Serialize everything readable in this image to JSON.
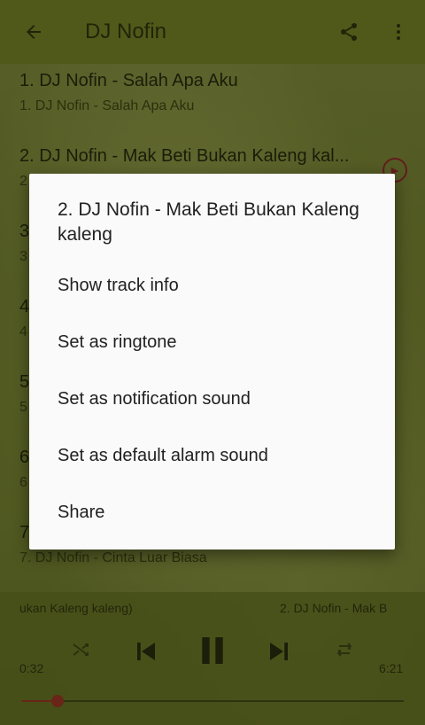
{
  "toolbar": {
    "back_icon": "arrow-back-icon",
    "title": "DJ Nofin",
    "share_icon": "share-icon",
    "more_icon": "more-vert-icon"
  },
  "tracks": [
    {
      "title": "1. DJ Nofin - Salah Apa Aku",
      "subtitle": "1. DJ Nofin - Salah Apa Aku"
    },
    {
      "title": "2. DJ Nofin - Mak Beti Bukan Kaleng kal...",
      "subtitle": "2"
    },
    {
      "title": "3",
      "subtitle": "3"
    },
    {
      "title": "4",
      "subtitle": "4"
    },
    {
      "title": "5",
      "subtitle": "5"
    },
    {
      "title": "6",
      "subtitle": "6"
    },
    {
      "title": "7",
      "subtitle": "7. DJ Nofin - Cinta Luar Biasa"
    }
  ],
  "player": {
    "marquee_left": "ukan Kaleng kaleng)",
    "marquee_right": "2. DJ Nofin - Mak B",
    "current_time": "0:32",
    "total_time": "6:21",
    "progress": 0.094
  },
  "dialog": {
    "title": "2. DJ Nofin - Mak Beti Bukan Kaleng kaleng",
    "items": [
      "Show track info",
      "Set as ringtone",
      "Set as notification sound",
      "Set as default alarm sound",
      "Share"
    ]
  },
  "colors": {
    "toolbar": "#8a9a2c",
    "accent": "#b3402a",
    "dialog_bg": "#fafafa"
  }
}
